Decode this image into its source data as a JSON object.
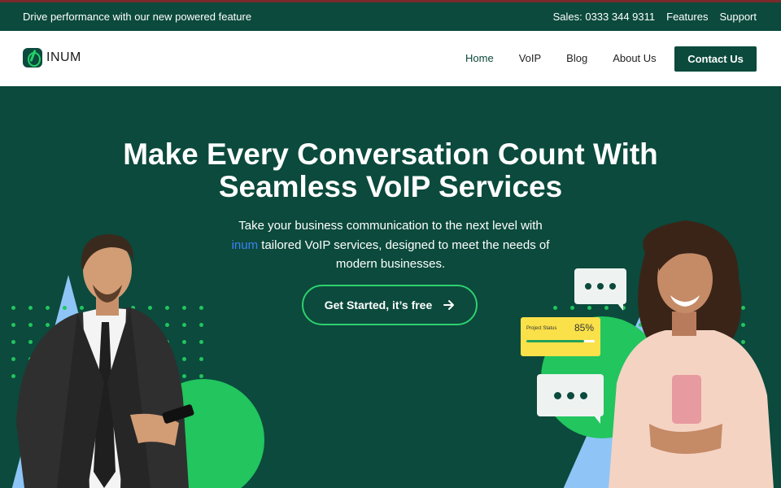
{
  "topbar": {
    "promo": "Drive performance with our new powered feature",
    "sales": "Sales: 0333 344 9311",
    "features": "Features",
    "support": "Support"
  },
  "nav": {
    "logo_text": "INUM",
    "items": [
      {
        "label": "Home",
        "active": true
      },
      {
        "label": "VoIP"
      },
      {
        "label": "Blog"
      },
      {
        "label": "About Us"
      }
    ],
    "contact_label": "Contact Us"
  },
  "hero": {
    "title_line1": "Make Every Conversation Count With",
    "title_line2": "Seamless VoIP Services",
    "sub_line1": "Take your business communication to the next level with",
    "sub_highlight": "inum",
    "sub_line2": " tailored VoIP services,  designed to meet the needs of",
    "sub_line3": "modern businesses.",
    "cta_label": "Get Started, it’s free",
    "cta_icon": "arrow-right-icon"
  },
  "status_card": {
    "label": "Project Status",
    "percent_text": "85%",
    "progress": 0.85
  },
  "colors": {
    "brand_dark": "#0b4a3c",
    "accent_green": "#22c55e",
    "accent_blue": "#8ec5f6",
    "highlight_blue": "#3b82f6",
    "status_yellow": "#fae14a"
  }
}
